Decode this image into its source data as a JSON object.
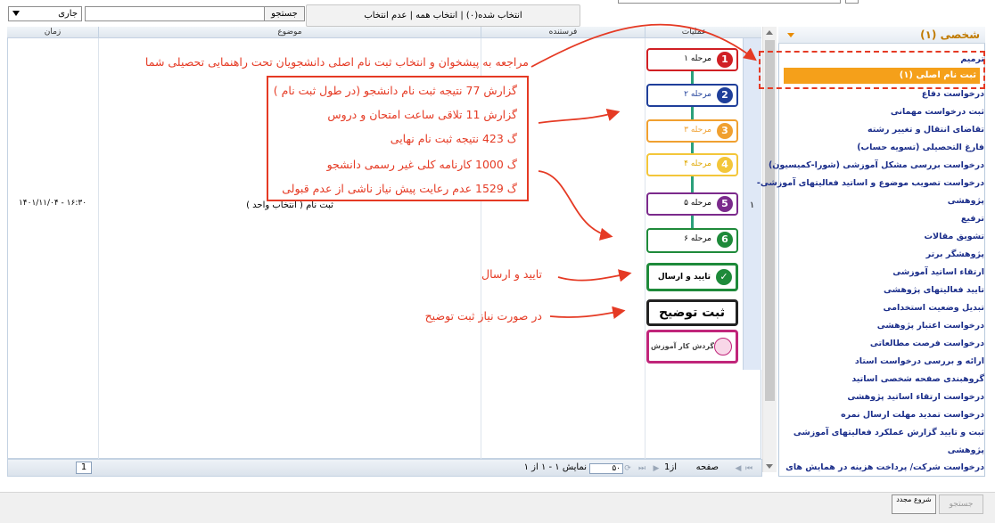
{
  "toolbar": {
    "search_button": "جستجو",
    "search_value": "",
    "status_select": "جاری",
    "selection_bar": "انتخاب شده(۰) | انتخاب همه | عدم انتخاب"
  },
  "grid": {
    "columns": [
      "عملیات",
      "فرستنده",
      "موضوع",
      "زمان"
    ],
    "rows": [
      {
        "num": "۱",
        "subject": "ثبت نام ( انتخاب واحد )",
        "sender": "",
        "time": "۱۴۰۱/۱۱/۰۴ - ۱۶:۳۰"
      }
    ]
  },
  "steps": [
    {
      "label": "مرحله ۱",
      "num": "1",
      "color": "#d01f24"
    },
    {
      "label": "مرحله ۲",
      "num": "2",
      "color": "#1f3f9a"
    },
    {
      "label": "مرحله ۳",
      "num": "3",
      "color": "#f0a030"
    },
    {
      "label": "مرحله ۴",
      "num": "4",
      "color": "#f3c63a"
    },
    {
      "label": "مرحله ۵",
      "num": "5",
      "color": "#7b2a8c"
    },
    {
      "label": "مرحله ۶",
      "num": "6",
      "color": "#1e8a3a"
    },
    {
      "label": "تایید و ارسال",
      "num": "✓",
      "color": "#1e8a3a"
    }
  ],
  "register_note": "ثبت توضیح",
  "workflow_label": "گردش کار آموزش",
  "annotations": {
    "top": "مراجعه به پیشخوان و انتخاب ثبت نام اصلی دانشجویان  تحت راهنمایی تحصیلی شما",
    "reports": [
      "گزارش 77 نتیجه ثبت نام دانشجو (در طول ثبت نام )",
      "گزارش 11 تلاقی ساعت امتحان و دروس",
      "گ 423 نتیجه ثبت نام نهایی",
      "گ 1000 کارنامه کلی غیر رسمی دانشجو",
      "گ 1529 عدم رعایت پیش نیاز ناشی از عدم قبولی"
    ],
    "confirm": "تایید و ارسال",
    "note": "در صورت نیاز ثبت توضیح"
  },
  "pager": {
    "page_label": "صفحه",
    "page": "1",
    "of_label": "از1",
    "per_page": "۵۰",
    "display": "نمایش ۱ - ۱ از ۱"
  },
  "sidebar": {
    "title": "شخصی (۱)",
    "items": [
      "ترمیم",
      "ثبت نام اصلی (۱)",
      "درخواست دفاع",
      "ثبت درخواست مهمانی",
      "تقاضای انتقال و تغییر رشته",
      "فارغ التحصیلی (تسویه حساب)",
      "درخواست بررسی مشکل آموزشی (شورا-کمیسیون)",
      "درخواست تصویب موضوع و اساتید فعالیتهای آموزشی-",
      "پژوهشی",
      "ترفیع",
      "تشویق مقالات",
      "پژوهشگر برتر",
      "ارتقاء اساتید آموزشی",
      "تایید فعالیتهای پژوهشی",
      "تبدیل وضعیت استخدامی",
      "درخواست اعتبار پژوهشی",
      "درخواست فرصت مطالعاتی",
      "ارائه و بررسی درخواست استاد",
      "گروهبندی صفحه شخصی اساتید",
      "درخواست ارتقاء اساتید پژوهشی",
      "درخواست تمدید مهلت ارسال نمره",
      "ثبت و تایید گزارش عملکرد فعالیتهای آموزشی",
      "پژوهشی",
      "درخواست شرکت/ پرداخت هزینه در همایش های"
    ]
  },
  "bottom": {
    "start_button": "شروع مجدد",
    "search_button": "جستجو"
  }
}
